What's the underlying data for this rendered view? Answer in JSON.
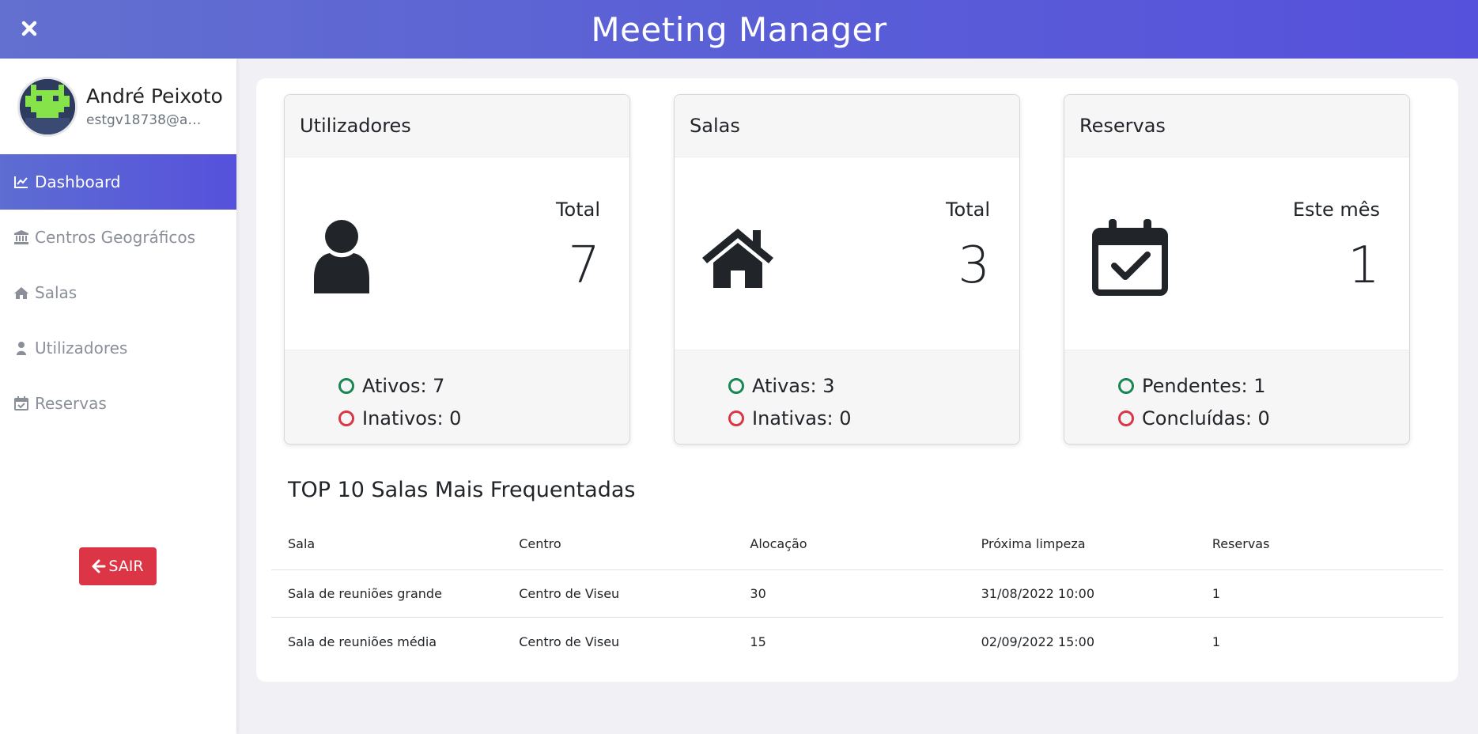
{
  "app": {
    "title": "Meeting Manager"
  },
  "user": {
    "name": "André Peixoto",
    "email": "estgv18738@alunos.estgv.ipv.pt"
  },
  "nav": [
    {
      "label": "Dashboard",
      "icon": "chart-line-icon",
      "active": true
    },
    {
      "label": "Centros Geográficos",
      "icon": "landmark-icon",
      "active": false
    },
    {
      "label": "Salas",
      "icon": "home-icon",
      "active": false
    },
    {
      "label": "Utilizadores",
      "icon": "user-icon",
      "active": false
    },
    {
      "label": "Reservas",
      "icon": "calendar-check-icon",
      "active": false
    }
  ],
  "logout": {
    "label": "SAIR",
    "icon": "arrow-left-icon"
  },
  "cards": [
    {
      "title": "Utilizadores",
      "icon": "user-icon",
      "stat_label": "Total",
      "stat_value": "7",
      "status": [
        {
          "label": "Ativos: 7",
          "color": "#198754"
        },
        {
          "label": "Inativos: 0",
          "color": "#dc3545"
        }
      ]
    },
    {
      "title": "Salas",
      "icon": "home-icon",
      "stat_label": "Total",
      "stat_value": "3",
      "status": [
        {
          "label": "Ativas: 3",
          "color": "#198754"
        },
        {
          "label": "Inativas: 0",
          "color": "#dc3545"
        }
      ]
    },
    {
      "title": "Reservas",
      "icon": "calendar-check-icon",
      "stat_label": "Este mês",
      "stat_value": "1",
      "status": [
        {
          "label": "Pendentes: 1",
          "color": "#198754"
        },
        {
          "label": "Concluídas: 0",
          "color": "#dc3545"
        }
      ]
    }
  ],
  "top_rooms": {
    "title": "TOP 10 Salas Mais Frequentadas",
    "columns": [
      "Sala",
      "Centro",
      "Alocação",
      "Próxima limpeza",
      "Reservas"
    ],
    "rows": [
      [
        "Sala de reuniões grande",
        "Centro de Viseu",
        "30",
        "31/08/2022 10:00",
        "1"
      ],
      [
        "Sala de reuniões média",
        "Centro de Viseu",
        "15",
        "02/09/2022 15:00",
        "1"
      ]
    ]
  },
  "colors": {
    "accent": "#5651dc",
    "danger": "#dc3545",
    "success": "#198754"
  }
}
